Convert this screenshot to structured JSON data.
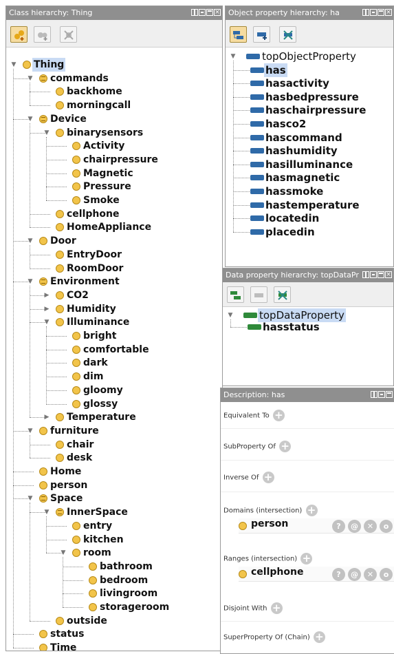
{
  "class_panel": {
    "title": "Class hierarchy: Thing",
    "tree": [
      {
        "id": "thing",
        "label": "Thing",
        "level": 0,
        "expanded": true,
        "selected": true
      },
      {
        "id": "commands",
        "label": "commands",
        "level": 1,
        "expanded": true,
        "defined": true
      },
      {
        "id": "backhome",
        "label": "backhome",
        "level": 2
      },
      {
        "id": "morningcall",
        "label": "morningcall",
        "level": 2
      },
      {
        "id": "device",
        "label": "Device",
        "level": 1,
        "expanded": true,
        "defined": true
      },
      {
        "id": "binarysensors",
        "label": "binarysensors",
        "level": 2,
        "expanded": true
      },
      {
        "id": "activity",
        "label": "Activity",
        "level": 3
      },
      {
        "id": "chairpressure",
        "label": "chairpressure",
        "level": 3
      },
      {
        "id": "magnetic",
        "label": "Magnetic",
        "level": 3
      },
      {
        "id": "pressure",
        "label": "Pressure",
        "level": 3
      },
      {
        "id": "smoke",
        "label": "Smoke",
        "level": 3
      },
      {
        "id": "cellphone",
        "label": "cellphone",
        "level": 2
      },
      {
        "id": "homeappliance",
        "label": "HomeAppliance",
        "level": 2
      },
      {
        "id": "door",
        "label": "Door",
        "level": 1,
        "expanded": true
      },
      {
        "id": "entrydoor",
        "label": "EntryDoor",
        "level": 2
      },
      {
        "id": "roomdoor",
        "label": "RoomDoor",
        "level": 2
      },
      {
        "id": "environment",
        "label": "Environment",
        "level": 1,
        "expanded": true,
        "defined": true
      },
      {
        "id": "co2",
        "label": "CO2",
        "level": 2,
        "expanded": false
      },
      {
        "id": "humidity",
        "label": "Humidity",
        "level": 2,
        "expanded": false
      },
      {
        "id": "illuminance",
        "label": "Illuminance",
        "level": 2,
        "expanded": true
      },
      {
        "id": "bright",
        "label": "bright",
        "level": 3
      },
      {
        "id": "comfortable",
        "label": "comfortable",
        "level": 3
      },
      {
        "id": "dark",
        "label": "dark",
        "level": 3
      },
      {
        "id": "dim",
        "label": "dim",
        "level": 3
      },
      {
        "id": "gloomy",
        "label": "gloomy",
        "level": 3
      },
      {
        "id": "glossy",
        "label": "glossy",
        "level": 3
      },
      {
        "id": "temperature",
        "label": "Temperature",
        "level": 2,
        "expanded": false
      },
      {
        "id": "furniture",
        "label": "furniture",
        "level": 1,
        "expanded": true
      },
      {
        "id": "chair",
        "label": "chair",
        "level": 2
      },
      {
        "id": "desk",
        "label": "desk",
        "level": 2
      },
      {
        "id": "home",
        "label": "Home",
        "level": 1
      },
      {
        "id": "person",
        "label": "person",
        "level": 1
      },
      {
        "id": "space",
        "label": "Space",
        "level": 1,
        "expanded": true,
        "defined": true
      },
      {
        "id": "innerspace",
        "label": "InnerSpace",
        "level": 2,
        "expanded": true,
        "defined": true
      },
      {
        "id": "entry",
        "label": "entry",
        "level": 3
      },
      {
        "id": "kitchen",
        "label": "kitchen",
        "level": 3
      },
      {
        "id": "room",
        "label": "room",
        "level": 3,
        "expanded": true
      },
      {
        "id": "bathroom",
        "label": "bathroom",
        "level": 4
      },
      {
        "id": "bedroom",
        "label": "bedroom",
        "level": 4
      },
      {
        "id": "livingroom",
        "label": "livingroom",
        "level": 4
      },
      {
        "id": "storageroom",
        "label": "storageroom",
        "level": 4
      },
      {
        "id": "outside",
        "label": "outside",
        "level": 2
      },
      {
        "id": "status",
        "label": "status",
        "level": 1
      },
      {
        "id": "time",
        "label": "Time",
        "level": 1
      }
    ]
  },
  "object_panel": {
    "title": "Object property hierarchy: ha",
    "root": "topObjectProperty",
    "items": [
      "has",
      "hasactivity",
      "hasbedpressure",
      "haschairpressure",
      "hasco2",
      "hascommand",
      "hashumidity",
      "hasilluminance",
      "hasmagnetic",
      "hassmoke",
      "hastemperature",
      "locatedin",
      "placedin"
    ],
    "selected": "has"
  },
  "data_panel": {
    "title": "Data property hierarchy: topDataPr",
    "root": "topDataProperty",
    "items": [
      "hasstatus"
    ]
  },
  "desc_panel": {
    "title": "Description: has",
    "sections": {
      "equivalent": "Equivalent To",
      "subproperty": "SubProperty Of",
      "inverse": "Inverse Of",
      "domains": "Domains (intersection)",
      "ranges": "Ranges (intersection)",
      "disjoint": "Disjoint With",
      "superchain": "SuperProperty Of (Chain)"
    },
    "domain_value": "person",
    "range_value": "cellphone"
  },
  "colors": {
    "class_icon": "#f2c44a",
    "object_property_icon": "#2f6aa8",
    "data_property_icon": "#2f8a3a",
    "selection": "#c9dbf4",
    "title_bar": "#8f8f8f"
  }
}
